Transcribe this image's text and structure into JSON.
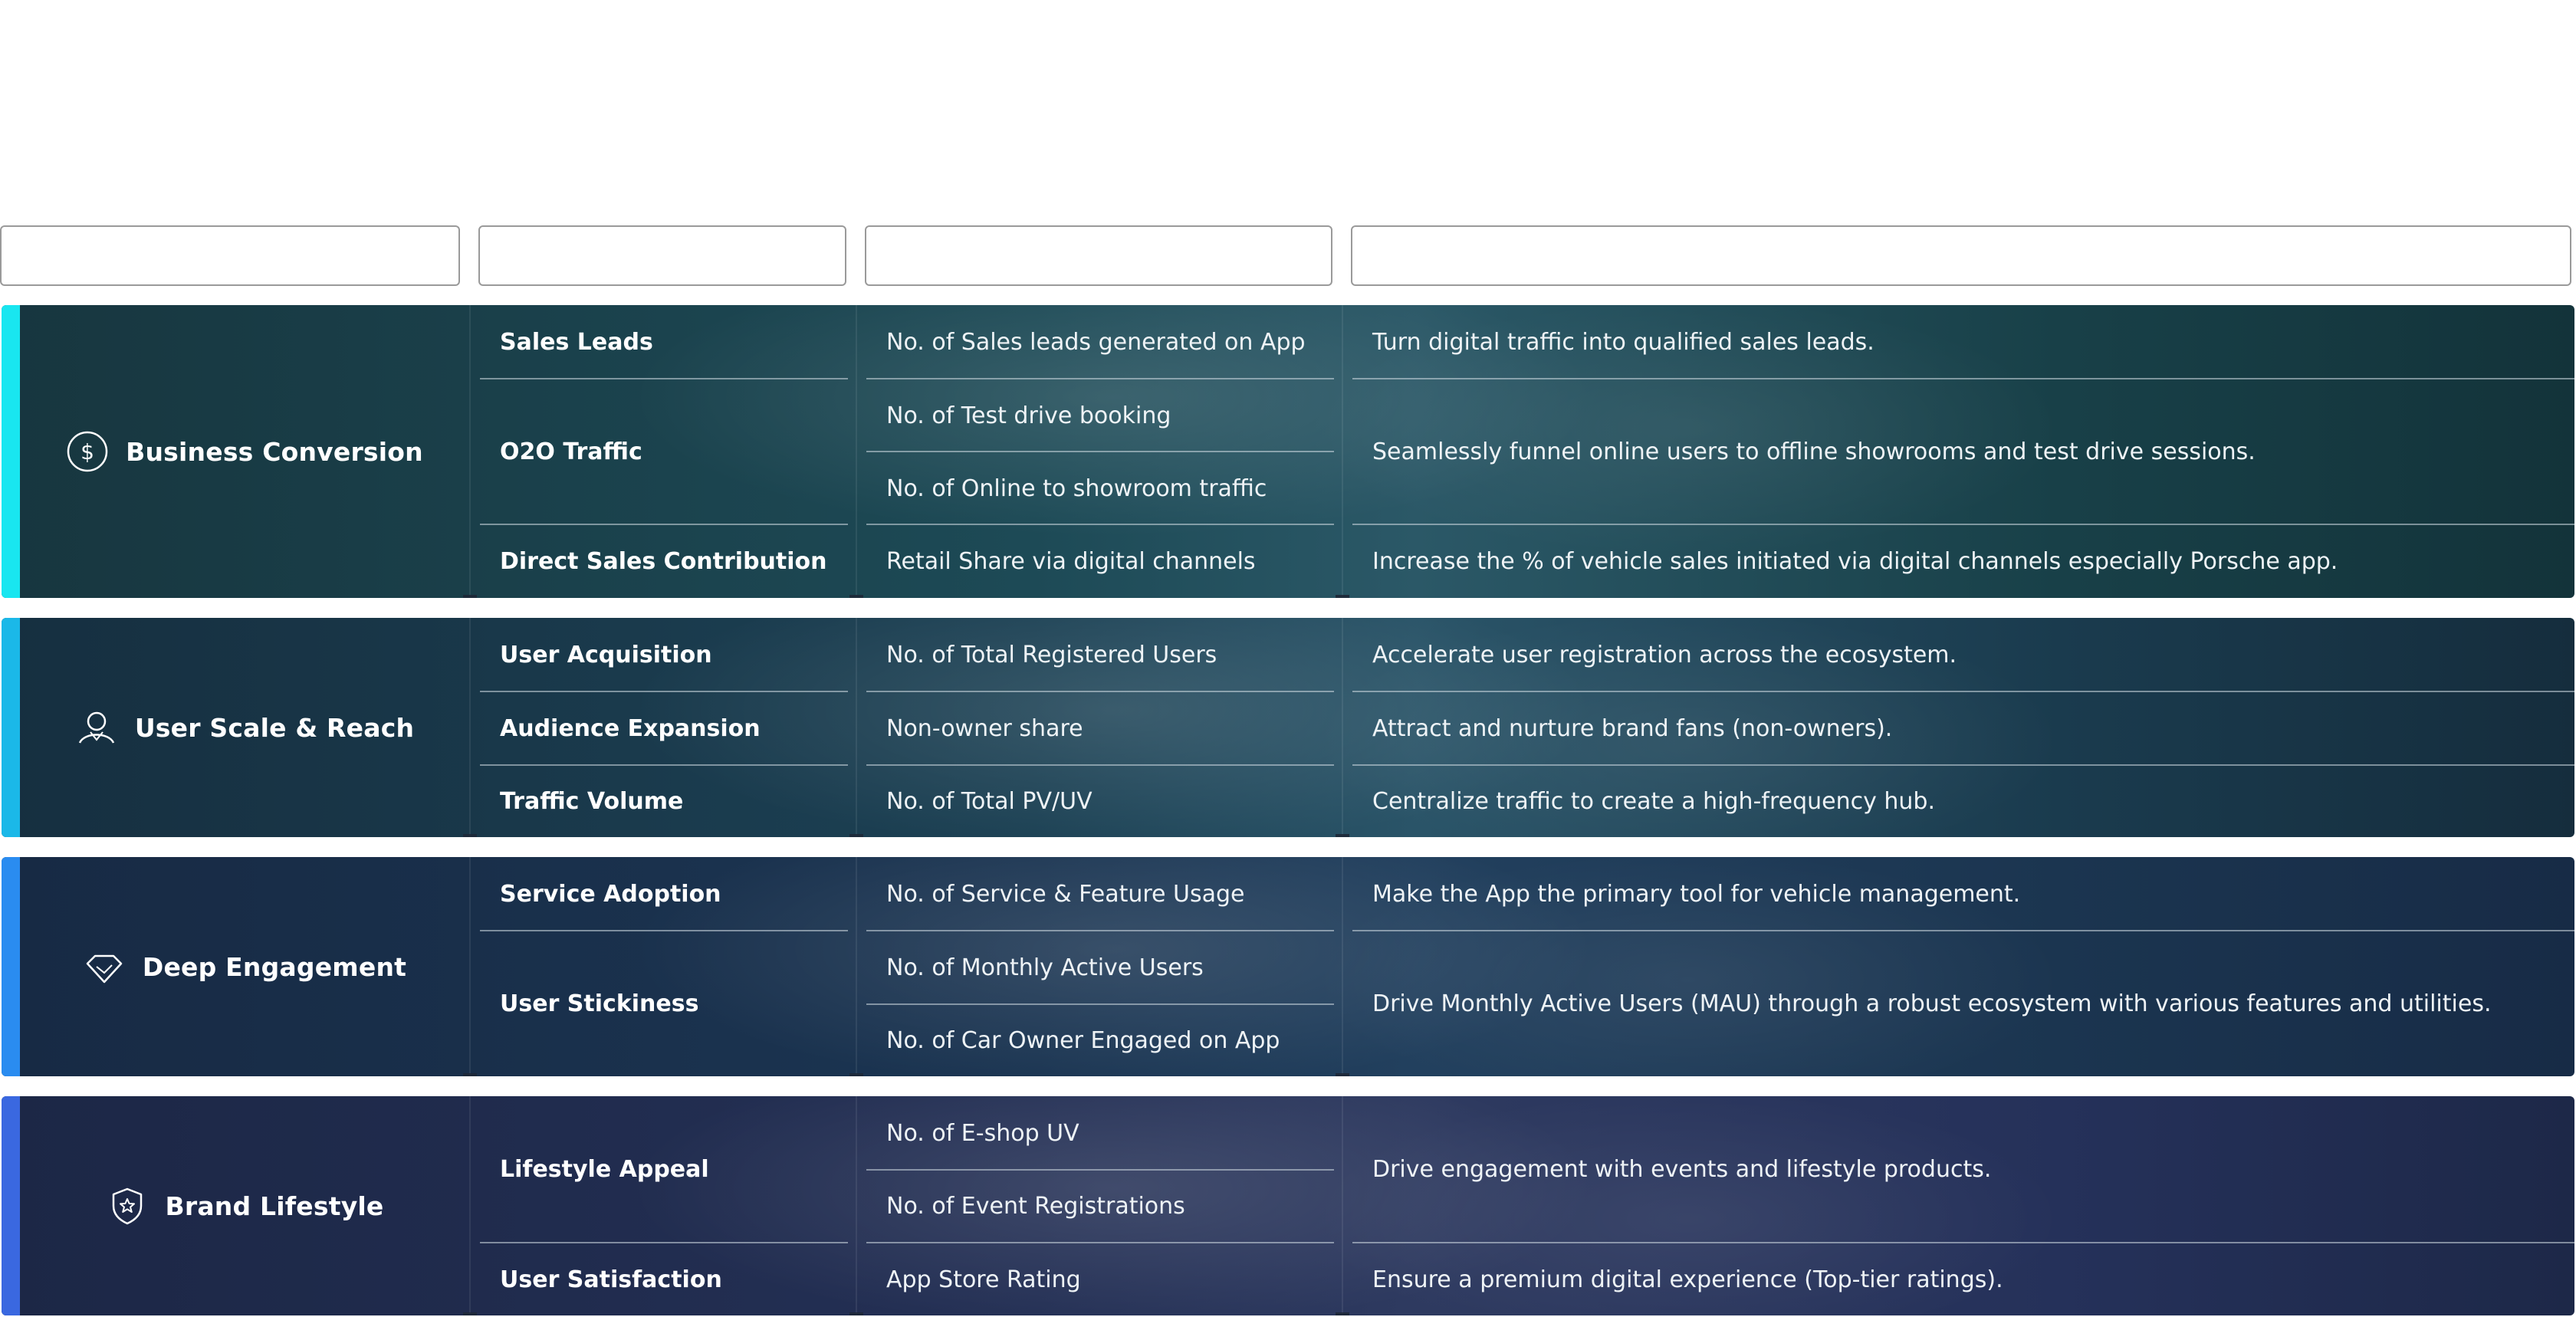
{
  "header_boxes": [
    "",
    "",
    "",
    ""
  ],
  "colors": {
    "band_1_accent": "#19e6f0",
    "band_2_accent": "#1bb8e8",
    "band_3_accent": "#2a8cf0",
    "band_4_accent": "#3a68e0"
  },
  "sections": [
    {
      "category": "Business Conversion",
      "icon": "dollar-circle-icon",
      "kpis": [
        {
          "name": "Sales Leads",
          "metrics": [
            "No. of Sales leads generated on App"
          ],
          "goal": "Turn digital traffic into qualified sales leads."
        },
        {
          "name": "O2O Traffic",
          "metrics": [
            "No. of Test drive booking",
            "No. of Online to showroom traffic"
          ],
          "goal": "Seamlessly funnel online users to offline showrooms and test drive sessions."
        },
        {
          "name": "Direct Sales Contribution",
          "metrics": [
            "Retail Share via digital channels"
          ],
          "goal": "Increase the % of vehicle sales initiated via digital channels especially Porsche app."
        }
      ]
    },
    {
      "category": "User Scale & Reach",
      "icon": "user-icon",
      "kpis": [
        {
          "name": "User Acquisition",
          "metrics": [
            "No. of Total Registered Users"
          ],
          "goal": "Accelerate user registration across the ecosystem."
        },
        {
          "name": "Audience Expansion",
          "metrics": [
            "Non-owner share"
          ],
          "goal": "Attract and nurture brand fans (non-owners)."
        },
        {
          "name": "Traffic Volume",
          "metrics": [
            "No. of Total PV/UV"
          ],
          "goal": "Centralize traffic to create a high-frequency hub."
        }
      ]
    },
    {
      "category": "Deep Engagement",
      "icon": "diamond-icon",
      "kpis": [
        {
          "name": "Service Adoption",
          "metrics": [
            "No. of Service & Feature Usage"
          ],
          "goal": "Make the App the primary tool for vehicle management."
        },
        {
          "name": "User Stickiness",
          "metrics": [
            "No. of Monthly Active Users",
            "No. of Car Owner Engaged on App"
          ],
          "goal": "Drive Monthly Active Users (MAU) through a robust ecosystem with various features and utilities."
        }
      ]
    },
    {
      "category": "Brand Lifestyle",
      "icon": "shield-star-icon",
      "kpis": [
        {
          "name": "Lifestyle Appeal",
          "metrics": [
            "No. of E-shop UV",
            "No. of Event Registrations"
          ],
          "goal": "Drive engagement with events and lifestyle products."
        },
        {
          "name": "User Satisfaction",
          "metrics": [
            "App Store Rating"
          ],
          "goal": "Ensure a premium digital experience (Top-tier ratings)."
        }
      ]
    }
  ]
}
